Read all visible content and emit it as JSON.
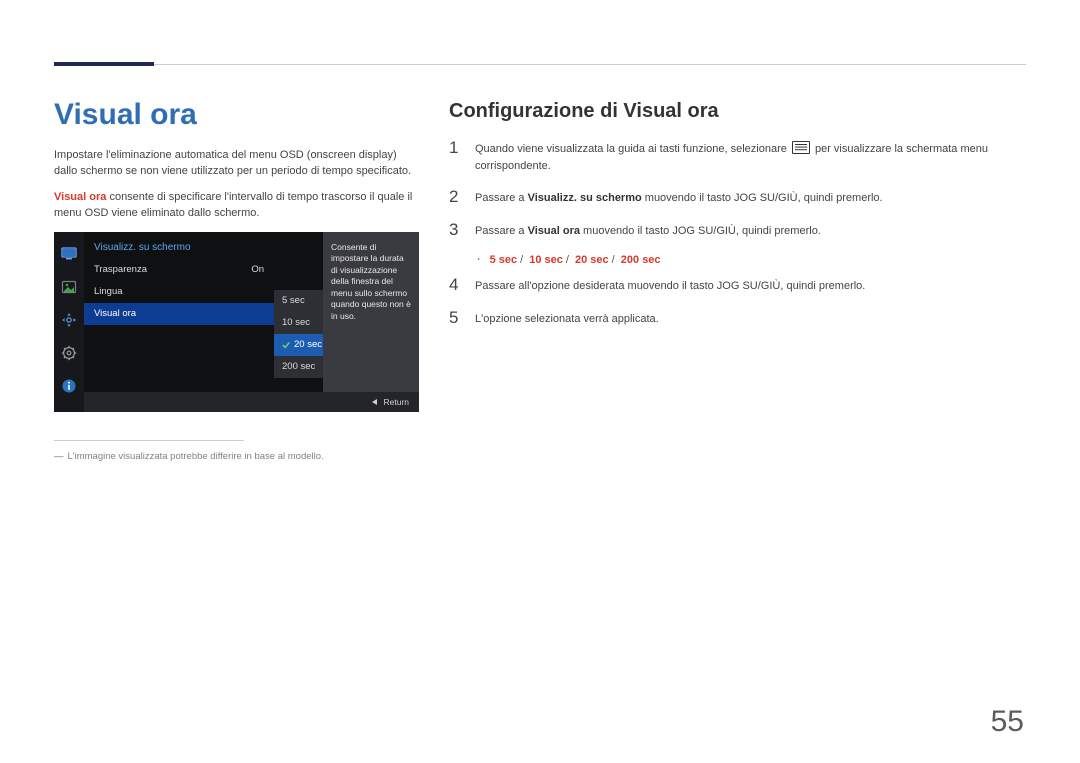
{
  "page_number": "55",
  "left": {
    "title": "Visual ora",
    "para1": "Impostare l'eliminazione automatica del menu OSD (onscreen display) dallo schermo se non viene utilizzato per un periodo di tempo specificato.",
    "para2_bold": "Visual ora",
    "para2_rest": " consente di specificare l'intervallo di tempo trascorso il quale il menu OSD viene eliminato dallo schermo.",
    "footnote": "L'immagine visualizzata potrebbe differire in base al modello."
  },
  "osd": {
    "header": "Visualizz. su schermo",
    "rows": [
      {
        "label": "Trasparenza",
        "value": "On",
        "selected": false
      },
      {
        "label": "Lingua",
        "value": "",
        "selected": false
      },
      {
        "label": "Visual ora",
        "value": "",
        "selected": true
      }
    ],
    "sub_options": [
      {
        "label": "5 sec",
        "selected": false
      },
      {
        "label": "10 sec",
        "selected": false
      },
      {
        "label": "20 sec",
        "selected": true
      },
      {
        "label": "200 sec",
        "selected": false
      }
    ],
    "description": "Consente di impostare la durata di visualizzazione della finestra del menu sullo schermo quando questo non è in uso.",
    "return_label": "Return"
  },
  "right": {
    "title": "Configurazione di Visual ora",
    "steps": {
      "s1_a": "Quando viene visualizzata la guida ai tasti funzione, selezionare ",
      "s1_b": " per visualizzare la schermata menu corrispondente.",
      "s2_a": "Passare a ",
      "s2_bold": "Visualizz. su schermo",
      "s2_b": " muovendo il tasto JOG SU/GIÙ, quindi premerlo.",
      "s3_a": "Passare a ",
      "s3_bold": "Visual ora",
      "s3_b": " muovendo il tasto JOG SU/GIÙ, quindi premerlo.",
      "s4": "Passare all'opzione desiderata muovendo il tasto JOG SU/GIÙ, quindi premerlo.",
      "s5": "L'opzione selezionata verrà applicata."
    },
    "options": [
      "5 sec",
      "10 sec",
      "20 sec",
      "200 sec"
    ]
  }
}
